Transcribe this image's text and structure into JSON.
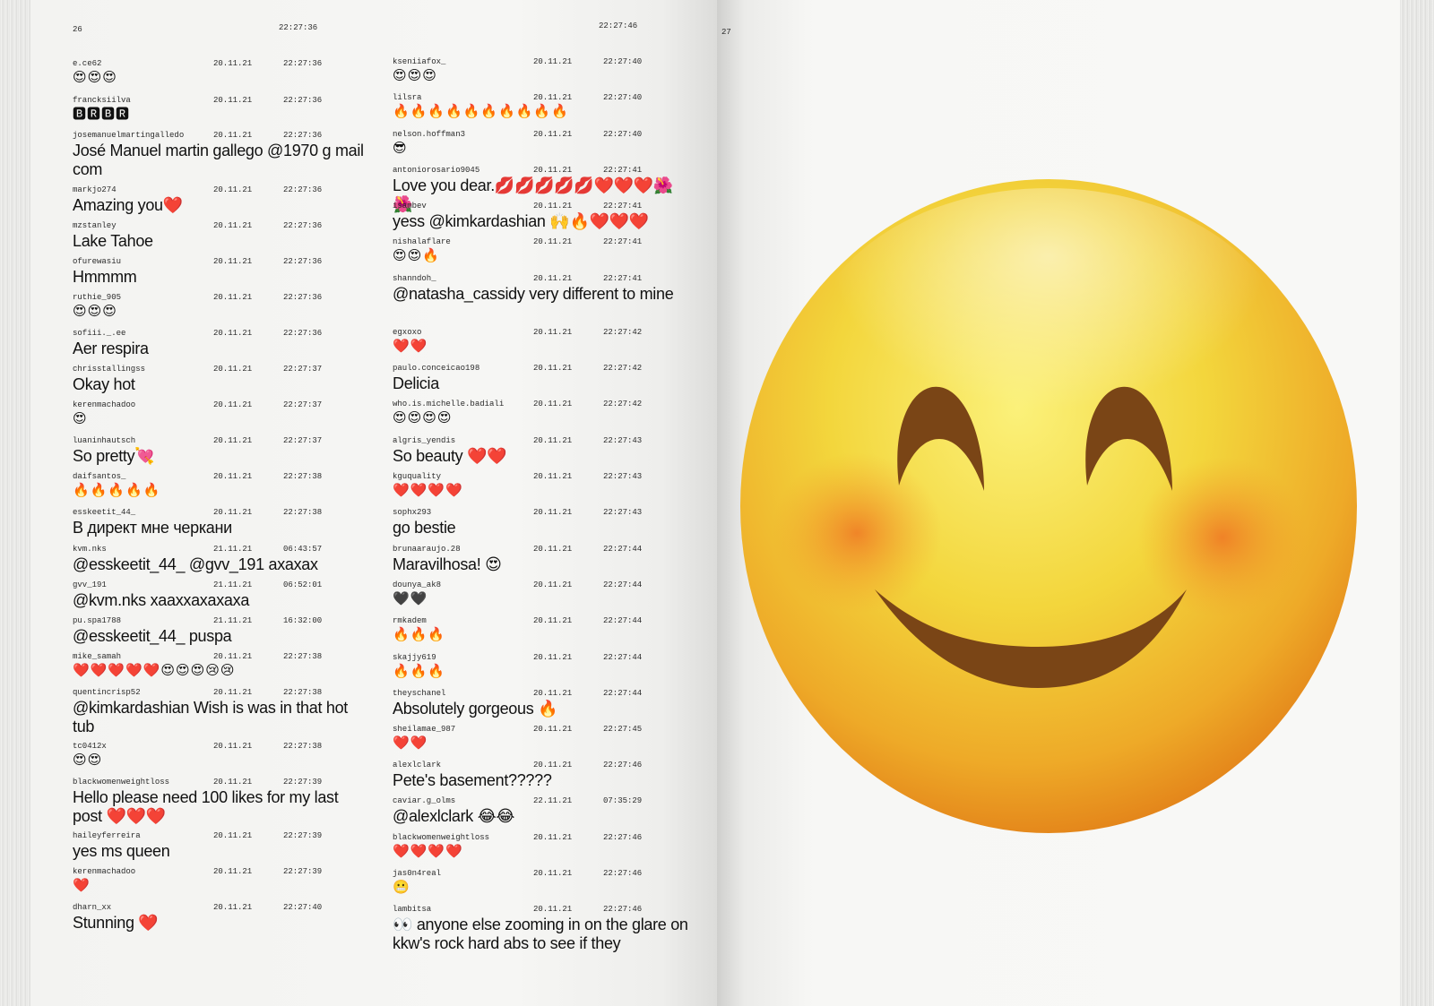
{
  "left_page": {
    "page_number": "26",
    "header_time_1": "22:27:36",
    "header_time_2": "22:27:46",
    "column_1": [
      {
        "user": "e.ce62",
        "date": "20.11.21",
        "time": "22:27:36",
        "text": "😍😍😍"
      },
      {
        "user": "francksiilva",
        "date": "20.11.21",
        "time": "22:27:36",
        "text": "🅱🆁🅱🆁"
      },
      {
        "user": "josemanuelmartingalledo",
        "date": "20.11.21",
        "time": "22:27:36",
        "text": "José Manuel martin gallego @1970 g mail com"
      },
      {
        "user": "markjo274",
        "date": "20.11.21",
        "time": "22:27:36",
        "text": "Amazing you❤️"
      },
      {
        "user": "mzstanley",
        "date": "20.11.21",
        "time": "22:27:36",
        "text": "Lake Tahoe"
      },
      {
        "user": "ofurewasiu",
        "date": "20.11.21",
        "time": "22:27:36",
        "text": "Hmmmm"
      },
      {
        "user": "ruthie_905",
        "date": "20.11.21",
        "time": "22:27:36",
        "text": "😍😍😍"
      },
      {
        "user": "sofiii._.ee",
        "date": "20.11.21",
        "time": "22:27:36",
        "text": "Aer respira"
      },
      {
        "user": "chrisstallingss",
        "date": "20.11.21",
        "time": "22:27:37",
        "text": "Okay hot"
      },
      {
        "user": "kerenmachadoo",
        "date": "20.11.21",
        "time": "22:27:37",
        "text": "😍"
      },
      {
        "user": "luaninhautsch",
        "date": "20.11.21",
        "time": "22:27:37",
        "text": "So pretty💘"
      },
      {
        "user": "daifsantos_",
        "date": "20.11.21",
        "time": "22:27:38",
        "text": "🔥🔥🔥🔥🔥"
      },
      {
        "user": "esskeetit_44_",
        "date": "20.11.21",
        "time": "22:27:38",
        "text": "В директ мне черкани"
      },
      {
        "user": "kvm.nks",
        "date": "21.11.21",
        "time": "06:43:57",
        "text": "@esskeetit_44_ @gvv_191 axaxax"
      },
      {
        "user": "gvv_191",
        "date": "21.11.21",
        "time": "06:52:01",
        "text": "@kvm.nks xaaxxaxaxaxa"
      },
      {
        "user": "pu.spa1788",
        "date": "21.11.21",
        "time": "16:32:00",
        "text": "@esskeetit_44_ puspa"
      },
      {
        "user": "mike_samah",
        "date": "20.11.21",
        "time": "22:27:38",
        "text": "❤️❤️❤️❤️❤️😍😍😍😢😢"
      },
      {
        "user": "quentincrisp52",
        "date": "20.11.21",
        "time": "22:27:38",
        "text": "@kimkardashian Wish is was in that hot tub"
      },
      {
        "user": "tc0412x",
        "date": "20.11.21",
        "time": "22:27:38",
        "text": "😍😍"
      },
      {
        "user": "blackwomenweightloss",
        "date": "20.11.21",
        "time": "22:27:39",
        "text": "Hello please need 100 likes for my last post ❤️❤️❤️"
      },
      {
        "user": "haileyferreira",
        "date": "20.11.21",
        "time": "22:27:39",
        "text": "yes ms queen"
      },
      {
        "user": "kerenmachadoo",
        "date": "20.11.21",
        "time": "22:27:39",
        "text": "❤️"
      },
      {
        "user": "dharn_xx",
        "date": "20.11.21",
        "time": "22:27:40",
        "text": "Stunning ❤️"
      }
    ],
    "column_2": [
      {
        "user": "kseniiafox_",
        "date": "20.11.21",
        "time": "22:27:40",
        "text": "😍😍😍"
      },
      {
        "user": "lilsra",
        "date": "20.11.21",
        "time": "22:27:40",
        "text": "🔥🔥🔥🔥🔥🔥🔥🔥🔥🔥"
      },
      {
        "user": "nelson.hoffman3",
        "date": "20.11.21",
        "time": "22:27:40",
        "text": "😎"
      },
      {
        "user": "antoniorosario9045",
        "date": "20.11.21",
        "time": "22:27:41",
        "text": "Love you dear.💋💋💋💋💋❤️❤️❤️🌺🌺"
      },
      {
        "user": "isambev",
        "date": "20.11.21",
        "time": "22:27:41",
        "text": "yess @kimkardashian 🙌🔥❤️❤️❤️"
      },
      {
        "user": "nishalaflare",
        "date": "20.11.21",
        "time": "22:27:41",
        "text": "😍😍🔥"
      },
      {
        "user": "shanndoh_",
        "date": "20.11.21",
        "time": "22:27:41",
        "text": "@natasha_cassidy very different to mine"
      },
      {
        "user": "egxoxo",
        "date": "20.11.21",
        "time": "22:27:42",
        "text": "❤️❤️"
      },
      {
        "user": "paulo.conceicao198",
        "date": "20.11.21",
        "time": "22:27:42",
        "text": "Delicia"
      },
      {
        "user": "who.is.michelle.badiali",
        "date": "20.11.21",
        "time": "22:27:42",
        "text": "😍😍😍😍"
      },
      {
        "user": "algris_yendis",
        "date": "20.11.21",
        "time": "22:27:43",
        "text": "So beauty ❤️❤️"
      },
      {
        "user": "kguquality",
        "date": "20.11.21",
        "time": "22:27:43",
        "text": "❤️❤️❤️❤️"
      },
      {
        "user": "sophx293",
        "date": "20.11.21",
        "time": "22:27:43",
        "text": "go bestie"
      },
      {
        "user": "brunaaraujo.28",
        "date": "20.11.21",
        "time": "22:27:44",
        "text": "Maravilhosa! 😍"
      },
      {
        "user": "dounya_ak8",
        "date": "20.11.21",
        "time": "22:27:44",
        "text": "🖤🖤"
      },
      {
        "user": "rmkadem",
        "date": "20.11.21",
        "time": "22:27:44",
        "text": "🔥🔥🔥"
      },
      {
        "user": "skajjy619",
        "date": "20.11.21",
        "time": "22:27:44",
        "text": "🔥🔥🔥"
      },
      {
        "user": "theyschanel",
        "date": "20.11.21",
        "time": "22:27:44",
        "text": "Absolutely gorgeous 🔥"
      },
      {
        "user": "sheilamae_987",
        "date": "20.11.21",
        "time": "22:27:45",
        "text": "❤️❤️"
      },
      {
        "user": "alexlclark",
        "date": "20.11.21",
        "time": "22:27:46",
        "text": "Pete's basement?????"
      },
      {
        "user": "caviar.g_olms",
        "date": "22.11.21",
        "time": "07:35:29",
        "text": "@alexlclark 😂😂"
      },
      {
        "user": "blackwomenweightloss",
        "date": "20.11.21",
        "time": "22:27:46",
        "text": "❤️❤️❤️❤️"
      },
      {
        "user": "jas0n4real",
        "date": "20.11.21",
        "time": "22:27:46",
        "text": "😬"
      },
      {
        "user": "lambitsa",
        "date": "20.11.21",
        "time": "22:27:46",
        "text": "👀 anyone else zooming in on the glare on kkw's rock hard abs to see if they"
      }
    ]
  },
  "right_page": {
    "page_number": "27",
    "image_icon": "smiling-face-with-blush-icon"
  },
  "colors": {
    "paper": "#f6f6f4",
    "text": "#111111",
    "emoji_yellow": "#f3cf3a",
    "emoji_orange": "#ec8f1f",
    "emoji_brown": "#7a4516"
  }
}
